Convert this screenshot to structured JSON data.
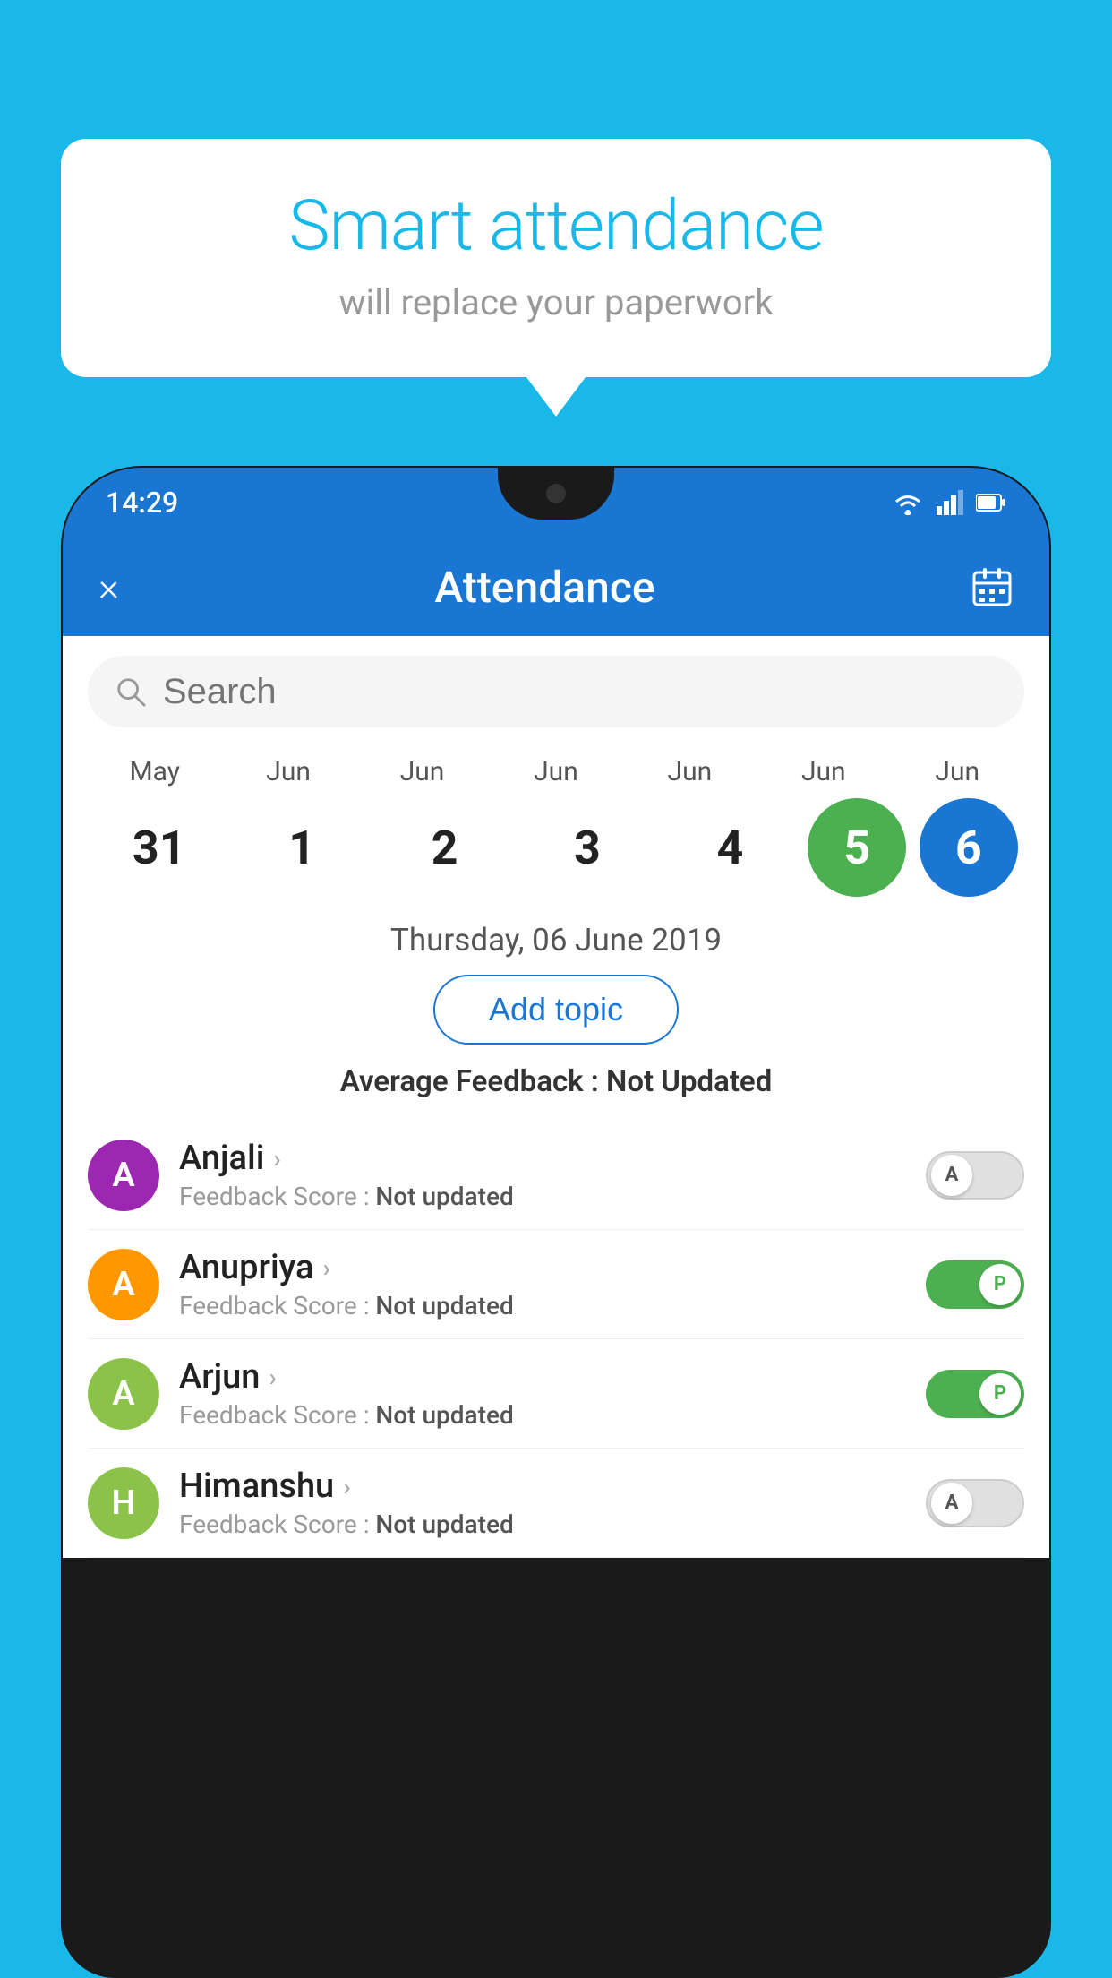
{
  "background_color": "#1ab8e8",
  "bubble": {
    "title": "Smart attendance",
    "subtitle": "will replace your paperwork"
  },
  "status_bar": {
    "time": "14:29",
    "icons": [
      "wifi",
      "signal",
      "battery"
    ]
  },
  "app_bar": {
    "title": "Attendance",
    "close_label": "×",
    "calendar_icon": "📅"
  },
  "search": {
    "placeholder": "Search"
  },
  "calendar": {
    "months": [
      "May",
      "Jun",
      "Jun",
      "Jun",
      "Jun",
      "Jun",
      "Jun"
    ],
    "days": [
      "31",
      "1",
      "2",
      "3",
      "4",
      "5",
      "6"
    ],
    "selected_green_index": 5,
    "selected_blue_index": 6
  },
  "selected_date": "Thursday, 06 June 2019",
  "add_topic_label": "Add topic",
  "average_feedback": {
    "label": "Average Feedback : ",
    "value": "Not Updated"
  },
  "students": [
    {
      "name": "Anjali",
      "avatar_letter": "A",
      "avatar_color": "#9c27b0",
      "feedback": "Not updated",
      "toggle_state": "off",
      "toggle_label": "A"
    },
    {
      "name": "Anupriya",
      "avatar_letter": "A",
      "avatar_color": "#ff9800",
      "feedback": "Not updated",
      "toggle_state": "on",
      "toggle_label": "P"
    },
    {
      "name": "Arjun",
      "avatar_letter": "A",
      "avatar_color": "#8bc34a",
      "feedback": "Not updated",
      "toggle_state": "on",
      "toggle_label": "P"
    },
    {
      "name": "Himanshu",
      "avatar_letter": "H",
      "avatar_color": "#8bc34a",
      "feedback": "Not updated",
      "toggle_state": "off",
      "toggle_label": "A"
    }
  ],
  "feedback_label": "Feedback Score : "
}
